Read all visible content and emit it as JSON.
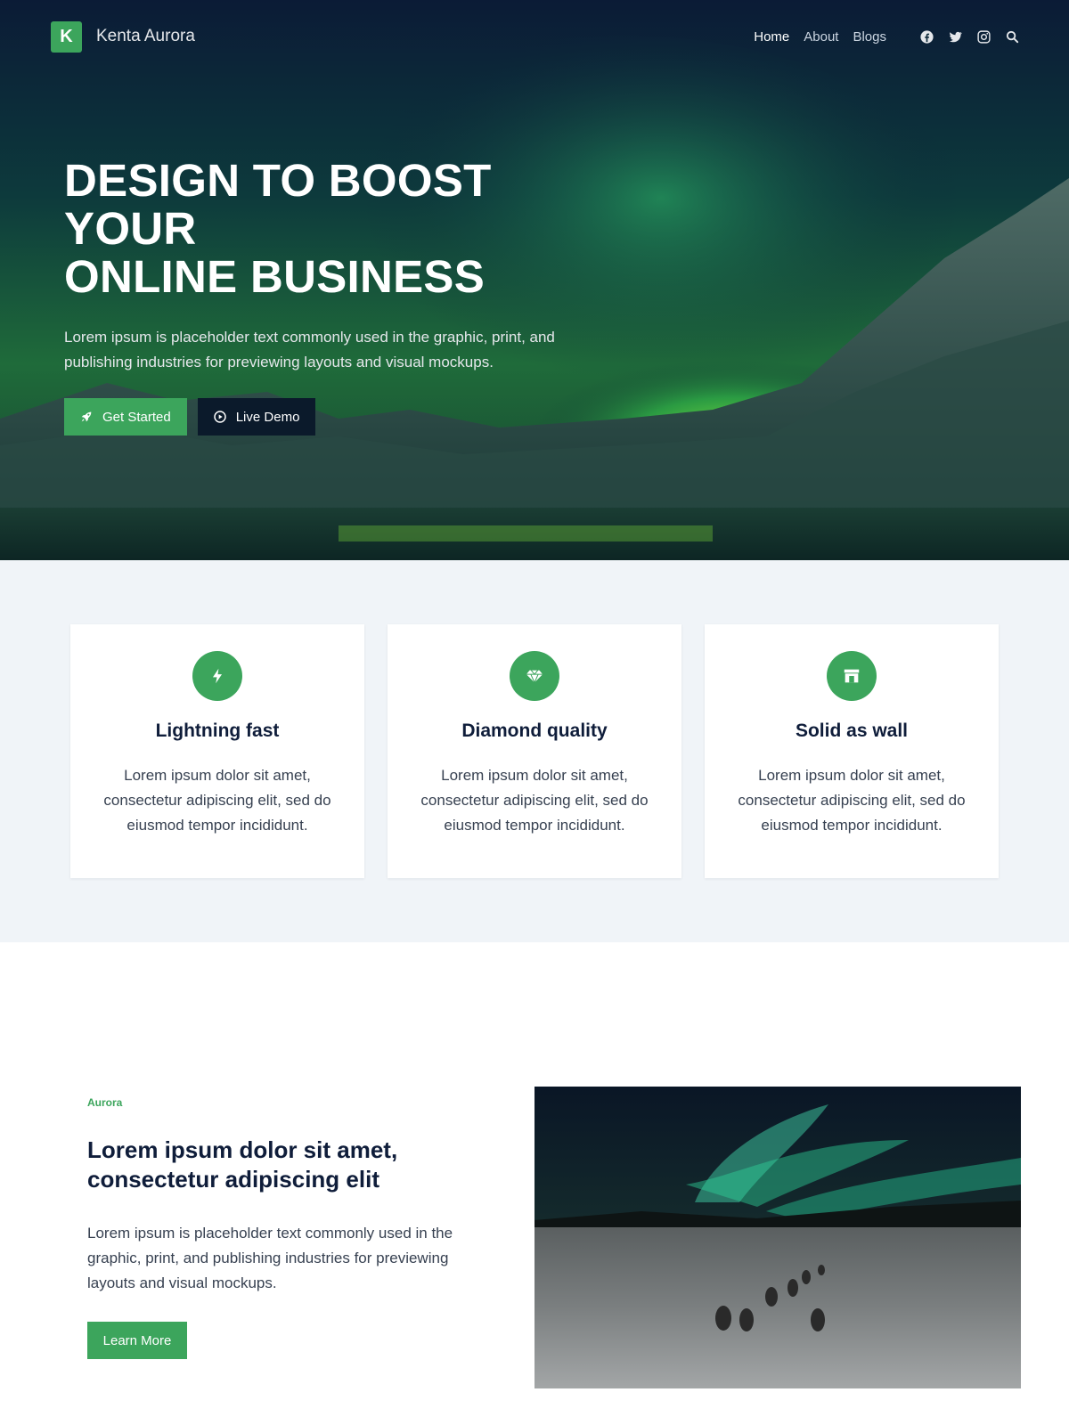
{
  "brand": {
    "logo_letter": "K",
    "name": "Kenta Aurora",
    "accent": "#3ca55c"
  },
  "nav": {
    "links": [
      {
        "label": "Home",
        "active": true
      },
      {
        "label": "About",
        "active": false
      },
      {
        "label": "Blogs",
        "active": false
      }
    ],
    "icons": [
      "facebook-icon",
      "twitter-icon",
      "instagram-icon",
      "search-icon"
    ]
  },
  "hero": {
    "title_line1": "DESIGN TO BOOST YOUR",
    "title_line2": "ONLINE BUSINESS",
    "description": "Lorem ipsum is placeholder text commonly used in the graphic, print, and publishing industries for previewing layouts and visual mockups.",
    "primary_button": "Get Started",
    "secondary_button": "Live Demo"
  },
  "features": [
    {
      "icon": "lightning-icon",
      "title": "Lightning fast",
      "text": "Lorem ipsum dolor sit amet, consectetur adipiscing elit, sed do eiusmod tempor incididunt."
    },
    {
      "icon": "diamond-icon",
      "title": "Diamond quality",
      "text": "Lorem ipsum dolor sit amet, consectetur adipiscing elit, sed do eiusmod tempor incididunt."
    },
    {
      "icon": "wall-icon",
      "title": "Solid as wall",
      "text": "Lorem ipsum dolor sit amet, consectetur adipiscing elit, sed do eiusmod tempor incididunt."
    }
  ],
  "about": {
    "kicker": "Aurora",
    "title_line1": "Lorem ipsum dolor sit amet,",
    "title_line2": "consectetur adipiscing elit",
    "text": "Lorem ipsum is placeholder text commonly used in the graphic, print, and publishing industries for previewing layouts and visual mockups.",
    "button": "Learn More"
  }
}
